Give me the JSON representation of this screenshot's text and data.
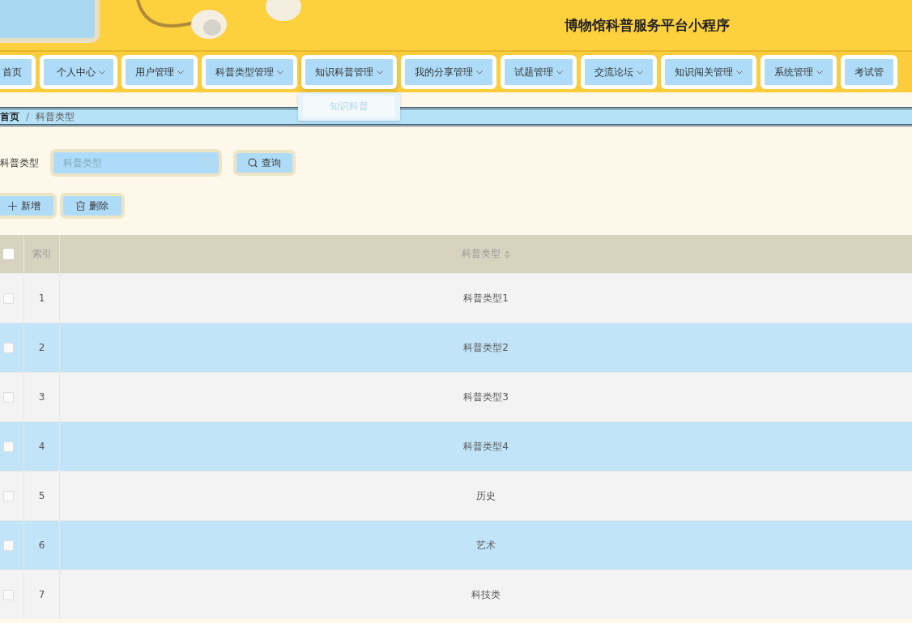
{
  "header": {
    "title": "博物馆科普服务平台小程序"
  },
  "nav": [
    {
      "label": "首页",
      "has_menu": false
    },
    {
      "label": "个人中心",
      "has_menu": true
    },
    {
      "label": "用户管理",
      "has_menu": true
    },
    {
      "label": "科普类型管理",
      "has_menu": true
    },
    {
      "label": "知识科普管理",
      "has_menu": true,
      "expanded": true,
      "menu": [
        "知识科普"
      ]
    },
    {
      "label": "我的分享管理",
      "has_menu": true
    },
    {
      "label": "试题管理",
      "has_menu": true
    },
    {
      "label": "交流论坛",
      "has_menu": true
    },
    {
      "label": "知识闯关管理",
      "has_menu": true
    },
    {
      "label": "系统管理",
      "has_menu": true
    },
    {
      "label": "考试管",
      "has_menu": false
    }
  ],
  "breadcrumb": {
    "items": [
      "首页",
      "科普类型"
    ],
    "separator": "/"
  },
  "search": {
    "label": "科普类型",
    "placeholder": "科普类型",
    "button": "查询"
  },
  "actions": [
    "新增",
    "删除"
  ],
  "table": {
    "all_checked": false,
    "columns": [
      "索引",
      "科普类型"
    ],
    "rows": [
      {
        "index": "1",
        "type": "科普类型1",
        "checked": false
      },
      {
        "index": "2",
        "type": "科普类型2",
        "checked": false
      },
      {
        "index": "3",
        "type": "科普类型3",
        "checked": false
      },
      {
        "index": "4",
        "type": "科普类型4",
        "checked": false
      },
      {
        "index": "5",
        "type": "历史",
        "checked": false
      },
      {
        "index": "6",
        "type": "艺术",
        "checked": false
      },
      {
        "index": "7",
        "type": "科技类",
        "checked": false
      }
    ]
  }
}
